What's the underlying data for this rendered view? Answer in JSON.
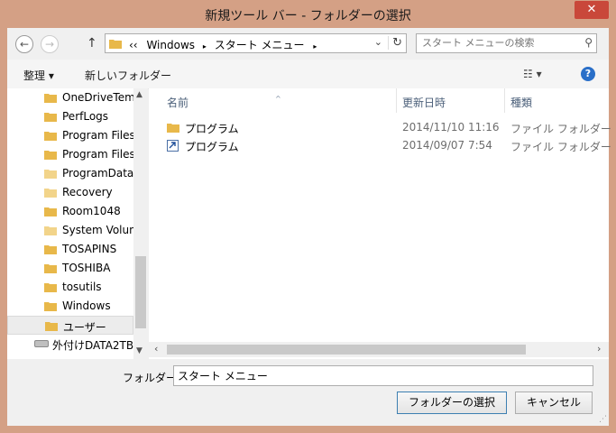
{
  "window": {
    "title": "新規ツール バー - フォルダーの選択",
    "close_glyph": "✕"
  },
  "nav_buttons": {
    "back": "←",
    "forward": "→",
    "up": "↑"
  },
  "address": {
    "overflow": "‹‹",
    "crumbs": [
      "Windows",
      "スタート メニュー"
    ],
    "separator": "▸",
    "dropdown": "⌄",
    "refresh": "↻"
  },
  "search": {
    "placeholder": "スタート メニューの検索",
    "icon": "⚲"
  },
  "toolbar": {
    "organize": "整理 ▾",
    "new_folder": "新しいフォルダー",
    "view": "☷ ▾",
    "help": "?"
  },
  "nav_tree": [
    {
      "label": "OneDriveTem"
    },
    {
      "label": "PerfLogs"
    },
    {
      "label": "Program Files"
    },
    {
      "label": "Program Files"
    },
    {
      "label": "ProgramData"
    },
    {
      "label": "Recovery"
    },
    {
      "label": "Room1048"
    },
    {
      "label": "System Volun"
    },
    {
      "label": "TOSAPINS"
    },
    {
      "label": "TOSHIBA"
    },
    {
      "label": "tosutils"
    },
    {
      "label": "Windows"
    },
    {
      "label": "ユーザー",
      "selected": true
    }
  ],
  "drive": {
    "label": "外付けDATA2TB"
  },
  "columns": {
    "name": "名前",
    "modified": "更新日時",
    "type": "種類",
    "sort_glyph": "^"
  },
  "files": [
    {
      "name": "プログラム",
      "modified": "2014/11/10 11:16",
      "type": "ファイル フォルダー",
      "kind": "folder"
    },
    {
      "name": "プログラム",
      "modified": "2014/09/07 7:54",
      "type": "ファイル フォルダー",
      "kind": "shortcut"
    }
  ],
  "scroll_glyphs": {
    "up": "▲",
    "down": "▼",
    "left": "‹",
    "right": "›",
    "grip": "⋰"
  },
  "bottom": {
    "folder_label": "フォルダー:",
    "folder_value": "スタート メニュー",
    "select_button": "フォルダーの選択",
    "cancel_button": "キャンセル"
  },
  "colors": {
    "title_bar": "#d4a085",
    "close": "#c9483a",
    "folder_icon": "#e8b84a",
    "help": "#2a6fc8"
  }
}
